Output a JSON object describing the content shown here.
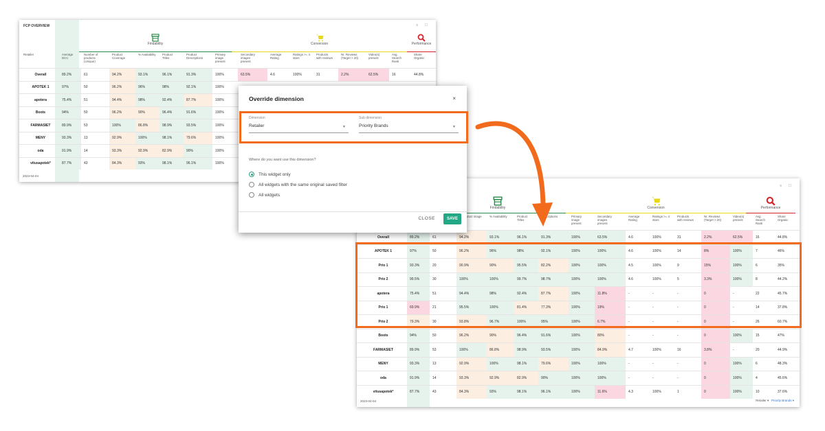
{
  "widget1": {
    "title": "FCP OVERVIEW",
    "window_controls": "≡ ☐",
    "groups": {
      "findability": "Findability",
      "conversion": "Conversion",
      "performance": "Performance"
    },
    "headers": [
      "Retailer",
      "Average DCC",
      "Number of products (Unique)",
      "Product Coverage",
      "% Availability",
      "Product Titles",
      "Product Descriptions",
      "Primary image present",
      "Secondary images present",
      "Average Rating",
      "Ratings >= 4 stars",
      "Products with reviews",
      "Nr. Reviews (Target > 20)",
      "Video(s) present",
      "Avg. Search Rank",
      "Share Organic"
    ],
    "rows": [
      {
        "label": "Overall",
        "cells": [
          "89.2%",
          "61",
          "94.2%",
          "93.1%",
          "96.1%",
          "91.3%",
          "100%",
          "63.5%",
          "4.6",
          "100%",
          "31",
          "2.2%",
          "62.5%",
          "16",
          "44.8%"
        ]
      },
      {
        "label": "APOTEK 1",
        "cells": [
          "97%",
          "50",
          "96.2%",
          "96%",
          "98%",
          "92.1%",
          "100%",
          "",
          "",
          "",
          "",
          "",
          "",
          "",
          ""
        ]
      },
      {
        "label": "apotera",
        "cells": [
          "75.4%",
          "51",
          "94.4%",
          "98%",
          "92.4%",
          "87.7%",
          "100%",
          "",
          "",
          "",
          "",
          "",
          "",
          "",
          ""
        ]
      },
      {
        "label": "Boots",
        "cells": [
          "94%",
          "50",
          "96.2%",
          "90%",
          "96.4%",
          "91.6%",
          "100%",
          "",
          "",
          "",
          "",
          "",
          "",
          "",
          ""
        ]
      },
      {
        "label": "FARMASIET",
        "cells": [
          "89.9%",
          "53",
          "100%",
          "86.8%",
          "98.9%",
          "93.5%",
          "100%",
          "",
          "",
          "",
          "",
          "",
          "",
          "",
          ""
        ]
      },
      {
        "label": "MENY",
        "cells": [
          "93.3%",
          "13",
          "92.9%",
          "100%",
          "98.1%",
          "79.6%",
          "100%",
          "",
          "",
          "",
          "",
          "",
          "",
          "",
          ""
        ]
      },
      {
        "label": "oda",
        "cells": [
          "91.9%",
          "14",
          "93.3%",
          "92.9%",
          "82.9%",
          "90%",
          "100%",
          "",
          "",
          "",
          "",
          "",
          "",
          "",
          ""
        ]
      },
      {
        "label": "vitusapotek*",
        "cells": [
          "87.7%",
          "43",
          "84.3%",
          "93%",
          "98.1%",
          "96.1%",
          "100%",
          "",
          "",
          "",
          "",
          "",
          "",
          "",
          ""
        ]
      }
    ],
    "date": "2023-04-04"
  },
  "modal": {
    "title": "Override dimension",
    "close_icon": "×",
    "dimension_label": "Dimension",
    "dimension_value": "Retailer",
    "sub_dimension_label": "Sub dimension",
    "sub_dimension_value": "Priority Brands",
    "question": "Where do you want use this dimension?",
    "options": [
      "This widget only",
      "All widgets with the same original saved filter",
      "All widgets"
    ],
    "selected_option": 0,
    "close_button": "CLOSE",
    "save_button": "SAVE"
  },
  "widget2": {
    "window_controls": "≡ ☐",
    "groups": {
      "findability": "Findability",
      "conversion": "Conversion",
      "performance": "Performance"
    },
    "headers": [
      "",
      "",
      "",
      "duct Image",
      "% Availability",
      "Product Titles",
      "Descriptions",
      "Primary image present",
      "Secondary images present",
      "Average Rating",
      "Ratings >= 4 stars",
      "Products with reviews",
      "Nr. Reviews (Target > 20)",
      "Video(s) present",
      "Avg. Search Rank",
      "Share Organic"
    ],
    "rows": [
      {
        "label": "Overall",
        "cells": [
          "89.2%",
          "61",
          "94.2%",
          "93.1%",
          "96.1%",
          "91.3%",
          "100%",
          "63.5%",
          "4.6",
          "100%",
          "31",
          "2.2%",
          "62.5%",
          "16",
          "44.8%"
        ]
      },
      {
        "label": "APOTEK 1",
        "cells": [
          "97%",
          "50",
          "96.2%",
          "96%",
          "98%",
          "92.1%",
          "100%",
          "100%",
          "4.6",
          "100%",
          "14",
          "8%",
          "100%",
          "7",
          "46%"
        ]
      },
      {
        "label": "Prio 1",
        "cells": [
          "93.3%",
          "20",
          "90.9%",
          "90%",
          "95.5%",
          "82.2%",
          "100%",
          "100%",
          "4.5",
          "100%",
          "9",
          "15%",
          "100%",
          "6",
          "35%"
        ]
      },
      {
        "label": "Prio 2",
        "cells": [
          "99.5%",
          "30",
          "100%",
          "100%",
          "99.7%",
          "98.7%",
          "100%",
          "100%",
          "4.6",
          "100%",
          "5",
          "3.3%",
          "100%",
          "8",
          "44.2%"
        ]
      },
      {
        "label": "apotera",
        "cells": [
          "75.4%",
          "51",
          "94.4%",
          "98%",
          "92.4%",
          "87.7%",
          "100%",
          "11.8%",
          "-",
          "-",
          "-",
          "0",
          "-",
          "22",
          "45.7%"
        ]
      },
      {
        "label": "Prio 1",
        "cells": [
          "69.9%",
          "21",
          "95.5%",
          "100%",
          "81.4%",
          "77.3%",
          "100%",
          "19%",
          "-",
          "-",
          "-",
          "0",
          "-",
          "14",
          "37.8%"
        ]
      },
      {
        "label": "Prio 2",
        "cells": [
          "79.3%",
          "30",
          "93.8%",
          "96.7%",
          "100%",
          "95%",
          "100%",
          "6.7%",
          "-",
          "-",
          "-",
          "0",
          "-",
          "26",
          "60.7%"
        ]
      },
      {
        "label": "Boots",
        "cells": [
          "94%",
          "50",
          "96.2%",
          "90%",
          "96.4%",
          "91.6%",
          "100%",
          "80%",
          "-",
          "-",
          "-",
          "0",
          "100%",
          "15",
          "47%"
        ]
      },
      {
        "label": "FARMASIET",
        "cells": [
          "89.9%",
          "53",
          "100%",
          "86.8%",
          "98.9%",
          "93.5%",
          "100%",
          "84.9%",
          "4.7",
          "100%",
          "16",
          "3.8%",
          "-",
          "20",
          "44.9%"
        ]
      },
      {
        "label": "MENY",
        "cells": [
          "93.3%",
          "13",
          "92.9%",
          "100%",
          "98.1%",
          "79.6%",
          "100%",
          "100%",
          "-",
          "-",
          "-",
          "0",
          "100%",
          "6",
          "48.3%"
        ]
      },
      {
        "label": "oda",
        "cells": [
          "91.9%",
          "14",
          "93.3%",
          "92.9%",
          "82.9%",
          "90%",
          "100%",
          "100%",
          "-",
          "-",
          "-",
          "0",
          "100%",
          "4",
          "45.6%"
        ]
      },
      {
        "label": "vitusapotek*",
        "cells": [
          "87.7%",
          "43",
          "84.3%",
          "93%",
          "98.1%",
          "96.1%",
          "100%",
          "11.6%",
          "4.3",
          "100%",
          "1",
          "0",
          "100%",
          "10",
          "37.6%"
        ]
      }
    ],
    "date": "2023-04-04",
    "footer_dimension": "Retailer",
    "footer_sub_dimension": "Priority Brands"
  },
  "colors": {
    "accent": "#f26a1b",
    "save": "#22a884",
    "findability": "#2a8c4a",
    "conversion": "#e8d81a",
    "performance": "#d8232a"
  }
}
